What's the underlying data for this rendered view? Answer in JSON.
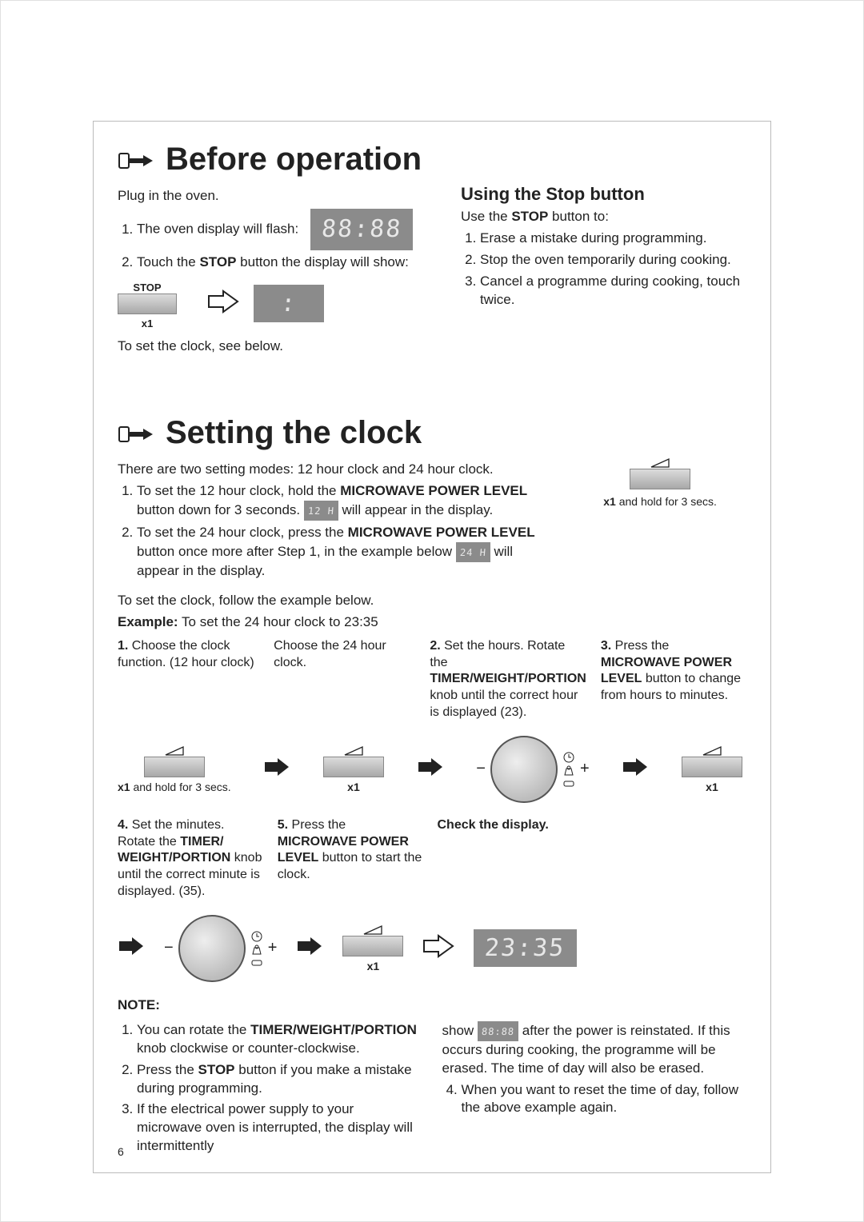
{
  "section1": {
    "title": "Before operation",
    "plug": "Plug in the oven.",
    "li1_a": "The oven display will flash:",
    "display1": "88:88",
    "li2_a": "Touch the ",
    "li2_b": "STOP",
    "li2_c": " button the display will show:",
    "stop_label": "STOP",
    "stop_x1": "x1",
    "display2": " : ",
    "toset": "To set the clock, see below.",
    "using_title": "Using the Stop button",
    "use_a": "Use the ",
    "use_b": "STOP",
    "use_c": " button to:",
    "u1": "Erase a mistake during programming.",
    "u2": "Stop the oven temporarily during cooking.",
    "u3": "Cancel a programme during cooking, touch twice."
  },
  "section2": {
    "title": "Setting the clock",
    "intro": "There are two setting modes: 12 hour clock and 24 hour clock.",
    "m1_a": "To set the 12 hour clock, hold the ",
    "m1_b": "MICROWAVE POWER LEVEL",
    "m1_c": " button down for 3 seconds. ",
    "m1_disp": "12 H",
    "m1_d": " will appear in the display.",
    "m2_a": "To set the 24 hour clock, press the ",
    "m2_b": "MICROWAVE POWER LEVEL",
    "m2_c": " button once more after Step 1, in the example below ",
    "m2_disp": "24 H",
    "m2_d": " will appear in the display.",
    "rb_x1a": "x1",
    "rb_x1b": " and hold for 3 secs.",
    "follow": "To set the clock, follow the example below.",
    "example_a": "Example:",
    "example_b": " To set the 24 hour clock to 23:35",
    "step1_a": "Choose the clock function. (12 hour clock)",
    "step1_b": "Choose the 24 hour clock.",
    "step2_a": "Set the hours. Rotate the ",
    "step2_b": "TIMER/WEIGHT/PORTION",
    "step2_c": " knob until the correct hour is displayed (23).",
    "step3_a": "Press the ",
    "step3_b": "MICROWAVE POWER LEVEL",
    "step3_c": " button to change from hours to minutes.",
    "btn1_sub_a": "x1",
    "btn1_sub_b": " and hold for 3 secs.",
    "btn2_sub": "x1",
    "btn3_sub": "x1",
    "step4_a": "Set the minutes. Rotate the ",
    "step4_b": "TIMER/ WEIGHT/PORTION",
    "step4_c": " knob until the correct minute is displayed. (35).",
    "step5_a": "Press the ",
    "step5_b": "MICROWAVE POWER LEVEL",
    "step5_c": " button to start the clock.",
    "check": "Check the display.",
    "x1c": "x1",
    "final_disp": "23:35",
    "note_h": "NOTE:",
    "n1_a": "You can rotate the ",
    "n1_b": "TIMER/WEIGHT/PORTION",
    "n1_c": " knob clockwise or counter-clockwise.",
    "n2_a": "Press the ",
    "n2_b": "STOP",
    "n2_c": " button if you make a mistake during programming.",
    "n3": "If the electrical power supply to your microwave oven is interrupted, the display will intermittently",
    "n3b_a": "show ",
    "n3b_disp": "88:88",
    "n3b_b": " after the power is reinstated. If this occurs during cooking, the programme will be erased. The time of day will also be erased.",
    "n4": "When you want to reset the time of day, follow the above example again."
  },
  "pagenum": "6"
}
